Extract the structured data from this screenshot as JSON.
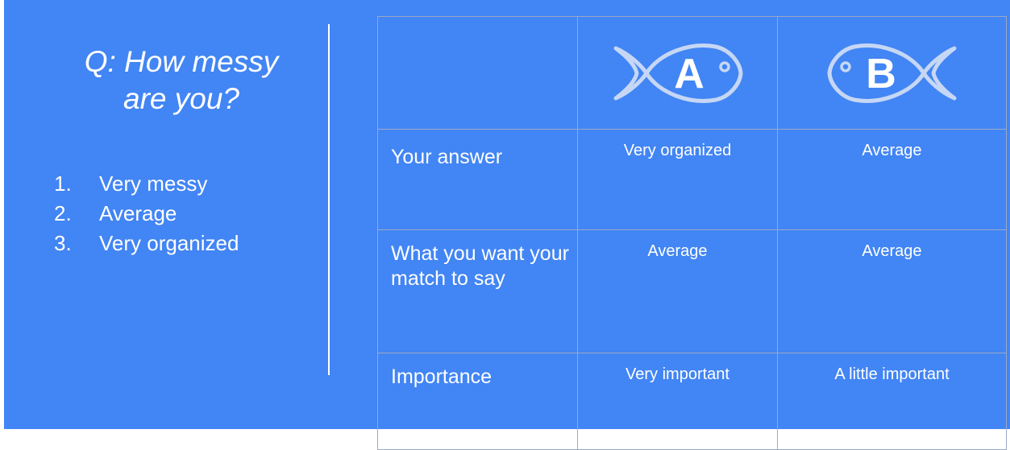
{
  "question": {
    "line1": "Q: How messy",
    "line2": "are you?"
  },
  "options": [
    {
      "num": "1.",
      "label": "Very messy"
    },
    {
      "num": "2.",
      "label": "Average"
    },
    {
      "num": "3.",
      "label": "Very organized"
    }
  ],
  "table": {
    "header": {
      "a": {
        "letter": "A",
        "icon": "fish-icon"
      },
      "b": {
        "letter": "B",
        "icon": "fish-icon"
      }
    },
    "rows": [
      {
        "label": "Your answer",
        "a": "Very organized",
        "b": "Average"
      },
      {
        "label": "What you want your match to say",
        "a": "Average",
        "b": "Average"
      },
      {
        "label": "Importance",
        "a": "Very important",
        "b": "A little important"
      }
    ]
  },
  "colors": {
    "background": "#4285f4",
    "text": "#ffffff",
    "grid_line": "#9aa9c4",
    "fish_outline": "#c6d7f5"
  }
}
